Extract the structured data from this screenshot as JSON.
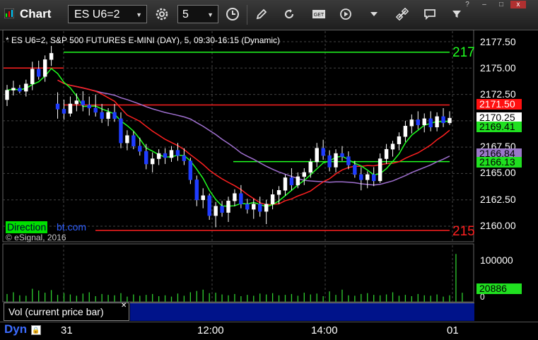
{
  "window": {
    "title": "Chart"
  },
  "toolbar": {
    "symbol": "ES U6=2",
    "interval": "5"
  },
  "chart": {
    "legend": "* ES U6=2, S&P 500 FUTURES E-MINI (DAY), 5, 09:30-16:15 (Dynamic)",
    "watermark_left": "Direction",
    "watermark_right": "bt.com",
    "copyright": "© eSignal, 2016",
    "right_label_top": "217",
    "right_label_bottom": "215",
    "price_axis": [
      "2177.50",
      "2175.00",
      "2172.50",
      "2167.50",
      "2165.00",
      "2162.50",
      "2160.00"
    ],
    "price_tags": {
      "red": "2171.50",
      "last": "2170.25",
      "green_ma": "2169.41",
      "purple_ma": "2166.84",
      "green_line": "2166.13"
    },
    "volume_axis": [
      "100000",
      "0"
    ],
    "volume_tag": "20886",
    "volume_label": "Vol (current price bar)",
    "time_axis": [
      "31",
      "12:00",
      "14:00",
      "01"
    ],
    "dyn_label": "Dyn"
  },
  "colors": {
    "up": "#ffffff",
    "down": "#1f3cff",
    "red_line": "#ff2020",
    "green_line": "#20ff20",
    "purple_line": "#a070d0",
    "volume": "#2fcf2f"
  },
  "chart_data": {
    "type": "candlestick",
    "y_unit": "price",
    "ylim": [
      2158.2,
      2179.6
    ],
    "levels": {
      "top_green": 2176.5,
      "red_resistance": 2171.5,
      "green_support": 2166.13,
      "red_support": 2159.6
    },
    "candles": [
      [
        2172.0,
        2173.4,
        2171.4,
        2172.9
      ],
      [
        2172.9,
        2173.8,
        2172.4,
        2173.1
      ],
      [
        2173.1,
        2173.4,
        2172.6,
        2172.8
      ],
      [
        2172.8,
        2173.9,
        2172.3,
        2173.5
      ],
      [
        2173.5,
        2175.6,
        2172.9,
        2174.9
      ],
      [
        2174.9,
        2175.7,
        2173.9,
        2174.2
      ],
      [
        2174.2,
        2176.2,
        2173.7,
        2175.8
      ],
      [
        2175.8,
        2177.1,
        2175.2,
        2176.4
      ],
      [
        2171.6,
        2172.7,
        2170.2,
        2171.1
      ],
      [
        2171.1,
        2172.0,
        2170.1,
        2170.7
      ],
      [
        2170.7,
        2172.3,
        2170.4,
        2171.6
      ],
      [
        2171.6,
        2172.6,
        2170.9,
        2171.9
      ],
      [
        2171.9,
        2172.8,
        2170.9,
        2171.5
      ],
      [
        2171.5,
        2172.3,
        2170.5,
        2171.2
      ],
      [
        2171.2,
        2172.5,
        2170.4,
        2170.8
      ],
      [
        2170.8,
        2171.6,
        2169.8,
        2170.2
      ],
      [
        2170.2,
        2171.2,
        2169.5,
        2170.8
      ],
      [
        2170.8,
        2171.6,
        2169.9,
        2170.2
      ],
      [
        2170.2,
        2170.8,
        2167.4,
        2167.9
      ],
      [
        2167.9,
        2169.1,
        2167.2,
        2168.6
      ],
      [
        2168.6,
        2169.0,
        2167.3,
        2167.6
      ],
      [
        2167.6,
        2168.4,
        2166.7,
        2167.1
      ],
      [
        2167.1,
        2167.8,
        2165.4,
        2165.9
      ],
      [
        2165.9,
        2167.0,
        2165.1,
        2166.4
      ],
      [
        2166.4,
        2167.3,
        2165.8,
        2166.9
      ],
      [
        2166.9,
        2167.4,
        2165.9,
        2166.5
      ],
      [
        2166.5,
        2167.6,
        2166.1,
        2167.2
      ],
      [
        2167.2,
        2167.9,
        2166.2,
        2166.7
      ],
      [
        2166.7,
        2167.4,
        2165.8,
        2166.2
      ],
      [
        2166.2,
        2166.5,
        2164.0,
        2164.4
      ],
      [
        2164.4,
        2164.8,
        2161.9,
        2162.5
      ],
      [
        2162.5,
        2163.6,
        2161.7,
        2162.9
      ],
      [
        2162.9,
        2163.1,
        2160.6,
        2161.0
      ],
      [
        2161.0,
        2162.3,
        2159.9,
        2161.9
      ],
      [
        2161.9,
        2162.4,
        2160.9,
        2161.3
      ],
      [
        2161.3,
        2162.8,
        2160.4,
        2162.4
      ],
      [
        2162.4,
        2163.5,
        2161.9,
        2163.1
      ],
      [
        2163.1,
        2163.9,
        2161.7,
        2162.1
      ],
      [
        2162.1,
        2162.6,
        2161.2,
        2161.6
      ],
      [
        2161.6,
        2162.6,
        2160.7,
        2162.1
      ],
      [
        2162.1,
        2162.8,
        2160.9,
        2161.4
      ],
      [
        2161.4,
        2162.5,
        2160.2,
        2162.1
      ],
      [
        2162.1,
        2163.5,
        2161.6,
        2163.0
      ],
      [
        2163.0,
        2163.8,
        2162.1,
        2163.4
      ],
      [
        2163.4,
        2164.9,
        2162.9,
        2164.6
      ],
      [
        2164.6,
        2165.5,
        2163.4,
        2163.9
      ],
      [
        2163.9,
        2165.1,
        2163.6,
        2164.7
      ],
      [
        2164.7,
        2165.5,
        2163.9,
        2165.1
      ],
      [
        2165.1,
        2166.4,
        2164.6,
        2166.1
      ],
      [
        2166.1,
        2167.9,
        2165.6,
        2167.4
      ],
      [
        2167.4,
        2168.2,
        2166.3,
        2166.7
      ],
      [
        2166.7,
        2167.2,
        2165.2,
        2165.6
      ],
      [
        2165.6,
        2167.3,
        2165.1,
        2166.9
      ],
      [
        2166.9,
        2167.6,
        2166.2,
        2166.6
      ],
      [
        2166.6,
        2167.1,
        2165.4,
        2165.8
      ],
      [
        2165.8,
        2166.2,
        2164.6,
        2164.9
      ],
      [
        2164.9,
        2165.6,
        2163.4,
        2164.4
      ],
      [
        2164.4,
        2165.2,
        2163.6,
        2164.9
      ],
      [
        2164.9,
        2165.6,
        2163.8,
        2164.3
      ],
      [
        2164.3,
        2166.9,
        2164.1,
        2166.4
      ],
      [
        2166.4,
        2167.8,
        2165.9,
        2167.3
      ],
      [
        2167.3,
        2168.1,
        2166.6,
        2167.8
      ],
      [
        2167.8,
        2168.9,
        2167.2,
        2168.5
      ],
      [
        2168.5,
        2170.0,
        2168.0,
        2169.5
      ],
      [
        2169.5,
        2170.6,
        2168.8,
        2170.1
      ],
      [
        2170.1,
        2170.9,
        2169.2,
        2169.6
      ],
      [
        2169.6,
        2170.7,
        2168.9,
        2170.2
      ],
      [
        2170.2,
        2170.9,
        2169.0,
        2169.4
      ],
      [
        2169.4,
        2170.8,
        2169.0,
        2170.4
      ],
      [
        2170.4,
        2171.2,
        2169.4,
        2169.8
      ],
      [
        2169.8,
        2170.9,
        2169.6,
        2170.25
      ]
    ],
    "volume_ylim": [
      0,
      130000
    ],
    "volume": [
      18000,
      22000,
      15000,
      14000,
      30000,
      26000,
      21000,
      27000,
      16000,
      20000,
      17000,
      14000,
      19000,
      22000,
      13000,
      18000,
      16000,
      15000,
      20000,
      12000,
      17000,
      14000,
      16000,
      18000,
      13000,
      15000,
      12000,
      19000,
      14000,
      22000,
      25000,
      28000,
      20000,
      21000,
      17000,
      15000,
      18000,
      13000,
      16000,
      14000,
      19000,
      17000,
      20000,
      15000,
      16000,
      18000,
      14000,
      21000,
      17000,
      19000,
      13000,
      24000,
      16000,
      28000,
      15000,
      14000,
      18000,
      20000,
      16000,
      15000,
      17000,
      22000,
      14000,
      16000,
      13000,
      18000,
      15000,
      14000,
      17000,
      12000,
      15000,
      110000,
      20886
    ]
  }
}
